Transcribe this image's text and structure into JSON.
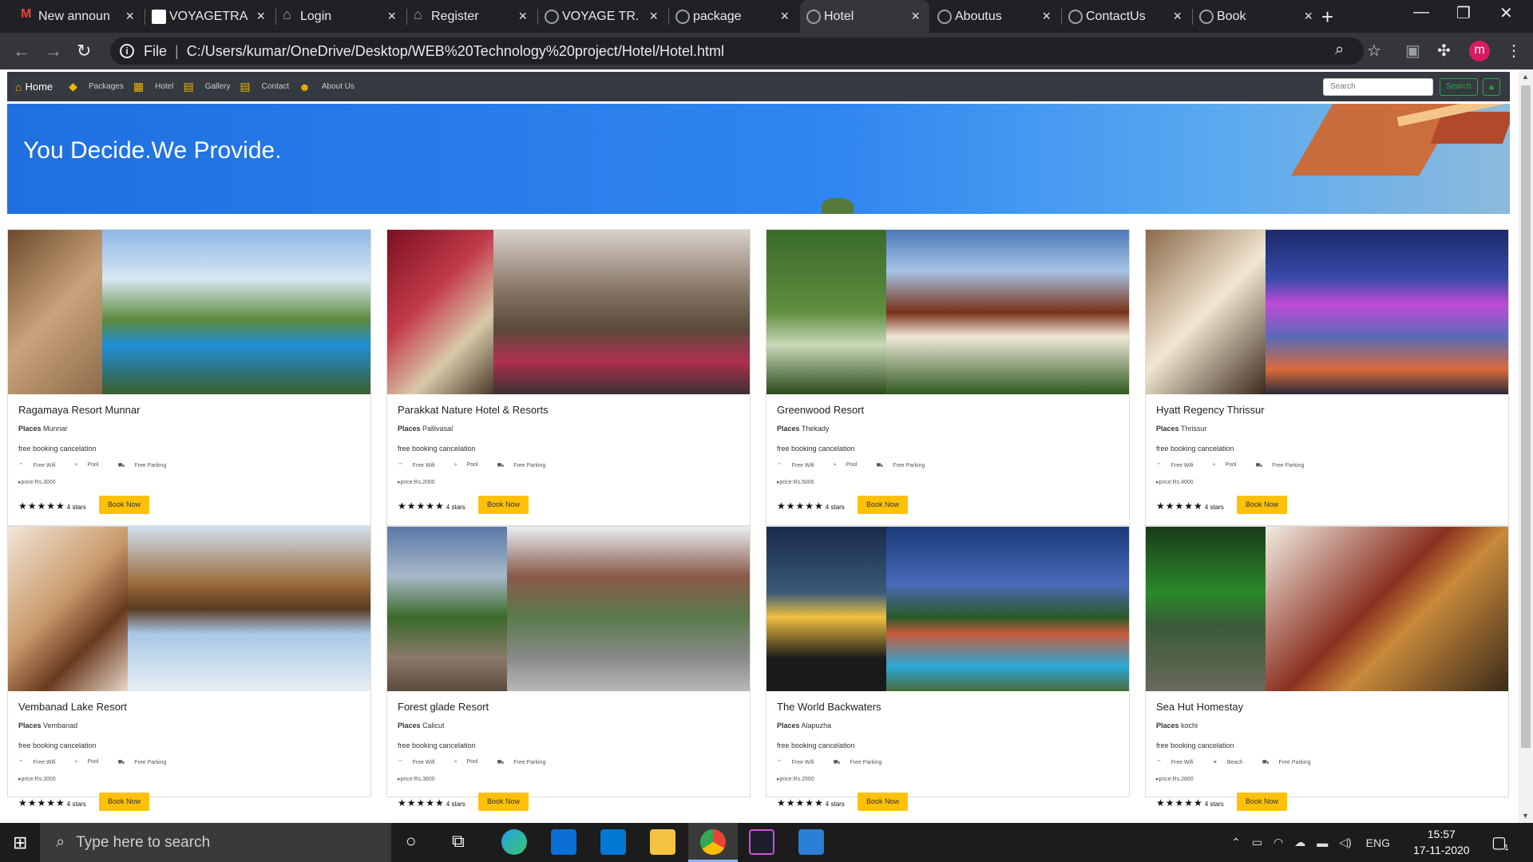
{
  "browser": {
    "tabs": [
      {
        "title": "New announ",
        "favicon": "gmail-icon"
      },
      {
        "title": "VOYAGETRA",
        "favicon": "document-icon"
      },
      {
        "title": "Login",
        "favicon": "home-icon"
      },
      {
        "title": "Register",
        "favicon": "home-icon"
      },
      {
        "title": "VOYAGE TR.",
        "favicon": "globe-icon"
      },
      {
        "title": "package",
        "favicon": "globe-icon"
      },
      {
        "title": "Hotel",
        "favicon": "globe-icon"
      },
      {
        "title": "Aboutus",
        "favicon": "globe-icon"
      },
      {
        "title": "ContactUs",
        "favicon": "globe-icon"
      },
      {
        "title": "Book",
        "favicon": "globe-icon"
      }
    ],
    "active_tab_index": 6,
    "scheme_label": "File",
    "url": "C:/Users/kumar/OneDrive/Desktop/WEB%20Technology%20project/Hotel/Hotel.html",
    "profile_initial": "m",
    "profile_color": "#d81b60"
  },
  "navbar": {
    "home": "Home",
    "items": [
      "Packages",
      "Hotel",
      "Gallery",
      "Contact",
      "About Us"
    ],
    "search_placeholder": "Search",
    "search_button": "Search"
  },
  "hero": {
    "heading": "You Decide.We Provide."
  },
  "hotels": [
    {
      "name": "Ragamaya Resort Munnar",
      "places_label": "Places",
      "place": "Munnar",
      "cancel": "free booking cancelation",
      "amenities": [
        "Free Wifi",
        "Pool",
        "Free Parking"
      ],
      "price": "price:Rs.3000",
      "stars": "★★★★★",
      "rating": "4 stars",
      "book": "Book Now"
    },
    {
      "name": "Parakkat Nature Hotel & Resorts",
      "places_label": "Places",
      "place": "Pallivasal",
      "cancel": "free booking cancelation",
      "amenities": [
        "Free Wifi",
        "Pool",
        "Free Parking"
      ],
      "price": "price:Rs.2000",
      "stars": "★★★★★",
      "rating": "4 stars",
      "book": "Book Now"
    },
    {
      "name": "Greenwood Resort",
      "places_label": "Places",
      "place": "Thekady",
      "cancel": "free booking cancelation",
      "amenities": [
        "Free Wifi",
        "Pool",
        "Free Parking"
      ],
      "price": "price:Rs.5000",
      "stars": "★★★★★",
      "rating": "4 stars",
      "book": "Book Now"
    },
    {
      "name": "Hyatt Regency Thrissur",
      "places_label": "Places",
      "place": "Thrissur",
      "cancel": "free booking cancelation",
      "amenities": [
        "Free Wifi",
        "Pool",
        "Free Parking"
      ],
      "price": "price:Rs.4000",
      "stars": "★★★★★",
      "rating": "4 stars",
      "book": "Book Now"
    },
    {
      "name": "Vembanad Lake Resort",
      "places_label": "Places",
      "place": "Vembanad",
      "cancel": "free booking cancelation",
      "amenities": [
        "Free Wifi",
        "Pool",
        "Free Parking"
      ],
      "price": "price:Rs.3000",
      "stars": "★★★★★",
      "rating": "4 stars",
      "book": "Book Now"
    },
    {
      "name": "Forest glade Resort",
      "places_label": "Places",
      "place": "Calicut",
      "cancel": "free booking cancelation",
      "amenities": [
        "Free Wifi",
        "Pool",
        "Free Parking"
      ],
      "price": "price:Rs.3600",
      "stars": "★★★★★",
      "rating": "4 stars",
      "book": "Book Now"
    },
    {
      "name": "The World Backwaters",
      "places_label": "Places",
      "place": "Alapuzha",
      "cancel": "free booking cancelation",
      "amenities": [
        "Free Wifi",
        "Free Parking"
      ],
      "price": "price:Rs.2500",
      "stars": "★★★★★",
      "rating": "4 stars",
      "book": "Book Now"
    },
    {
      "name": "Sea Hut Homestay",
      "places_label": "Places",
      "place": "kochi",
      "cancel": "free booking cancelation",
      "amenities": [
        "Free Wifi",
        "Beach",
        "Free Parking"
      ],
      "price": "price:Rs.2800",
      "stars": "★★★★★",
      "rating": "4 stars",
      "book": "Book Now"
    }
  ],
  "taskbar": {
    "search_placeholder": "Type here to search",
    "language": "ENG",
    "time": "15:57",
    "date": "17-11-2020",
    "notification_count": "1"
  },
  "colors": {
    "accent": "#ffc107",
    "navbar": "#343a40",
    "hero": "#2f86f0",
    "search_green": "#28a745"
  }
}
